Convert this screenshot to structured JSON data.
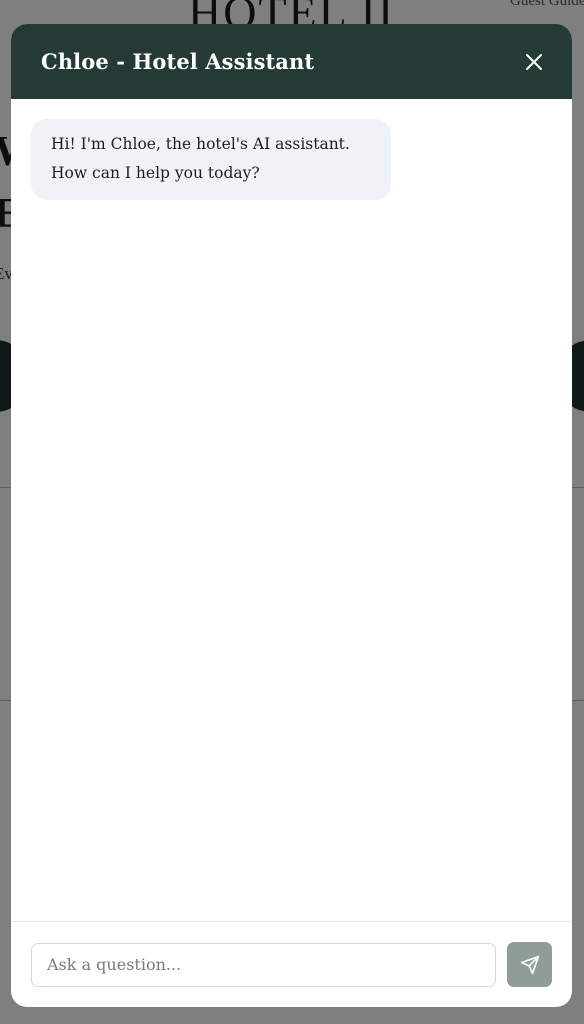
{
  "background": {
    "logo_text": "HOTEL II",
    "nav_link": "Guest Guide",
    "heading_line1": "W",
    "heading_line2": "E",
    "paragraph": "Ev"
  },
  "chat": {
    "title": "Chloe - Hotel Assistant",
    "close_icon": "close-icon",
    "messages": [
      {
        "sender": "assistant",
        "text": "Hi! I'm Chloe, the hotel's AI assistant. How can I help you today?"
      }
    ],
    "input": {
      "value": "",
      "placeholder": "Ask a question..."
    },
    "send_icon": "send-icon"
  },
  "colors": {
    "header_bg": "#243a34",
    "bubble_bg": "#eff3f8",
    "send_button_bg": "#8f9c98"
  }
}
